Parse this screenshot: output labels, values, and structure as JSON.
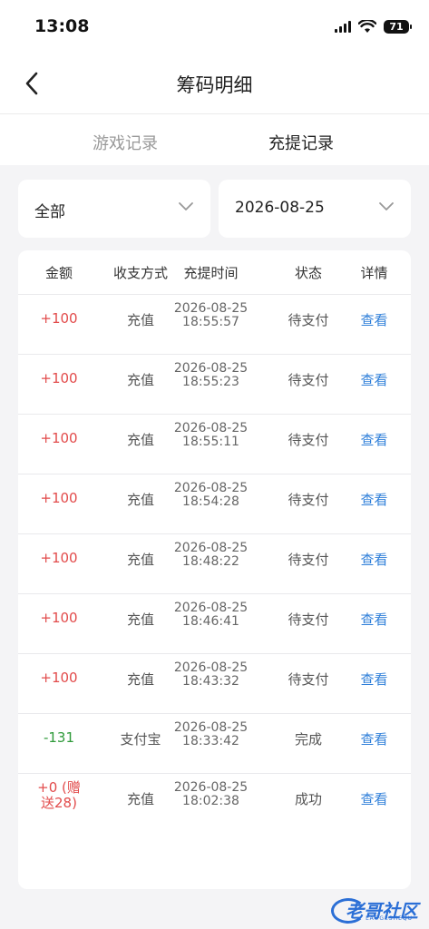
{
  "status_bar": {
    "time": "13:08",
    "battery": "71"
  },
  "header": {
    "title": "筹码明细"
  },
  "tabs": [
    {
      "label": "游戏记录",
      "active": false
    },
    {
      "label": "充提记录",
      "active": true
    }
  ],
  "filters": {
    "type": "全部",
    "date": "2026-08-25"
  },
  "table": {
    "columns": [
      "金额",
      "收支方式",
      "充提时间",
      "状态",
      "详情"
    ],
    "rows": [
      {
        "amount": "+100",
        "method": "充值",
        "date": "2026-08-25",
        "time": "18:55:57",
        "status": "待支付",
        "detail": "查看"
      },
      {
        "amount": "+100",
        "method": "充值",
        "date": "2026-08-25",
        "time": "18:55:23",
        "status": "待支付",
        "detail": "查看"
      },
      {
        "amount": "+100",
        "method": "充值",
        "date": "2026-08-25",
        "time": "18:55:11",
        "status": "待支付",
        "detail": "查看"
      },
      {
        "amount": "+100",
        "method": "充值",
        "date": "2026-08-25",
        "time": "18:54:28",
        "status": "待支付",
        "detail": "查看"
      },
      {
        "amount": "+100",
        "method": "充值",
        "date": "2026-08-25",
        "time": "18:48:22",
        "status": "待支付",
        "detail": "查看"
      },
      {
        "amount": "+100",
        "method": "充值",
        "date": "2026-08-25",
        "time": "18:46:41",
        "status": "待支付",
        "detail": "查看"
      },
      {
        "amount": "+100",
        "method": "充值",
        "date": "2026-08-25",
        "time": "18:43:32",
        "status": "待支付",
        "detail": "查看"
      },
      {
        "amount": "-131",
        "method": "支付宝",
        "date": "2026-08-25",
        "time": "18:33:42",
        "status": "完成",
        "detail": "查看"
      },
      {
        "amount": "+0 (赠送28)",
        "method": "充值",
        "date": "2026-08-25",
        "time": "18:02:38",
        "status": "成功",
        "detail": "查看"
      }
    ]
  },
  "colors": {
    "positive": "#e24b4b",
    "negative": "#2f9a3a",
    "link": "#2f7fd9"
  },
  "watermark": {
    "text": "老哥社区",
    "sub": "LAOGESHEQU"
  }
}
